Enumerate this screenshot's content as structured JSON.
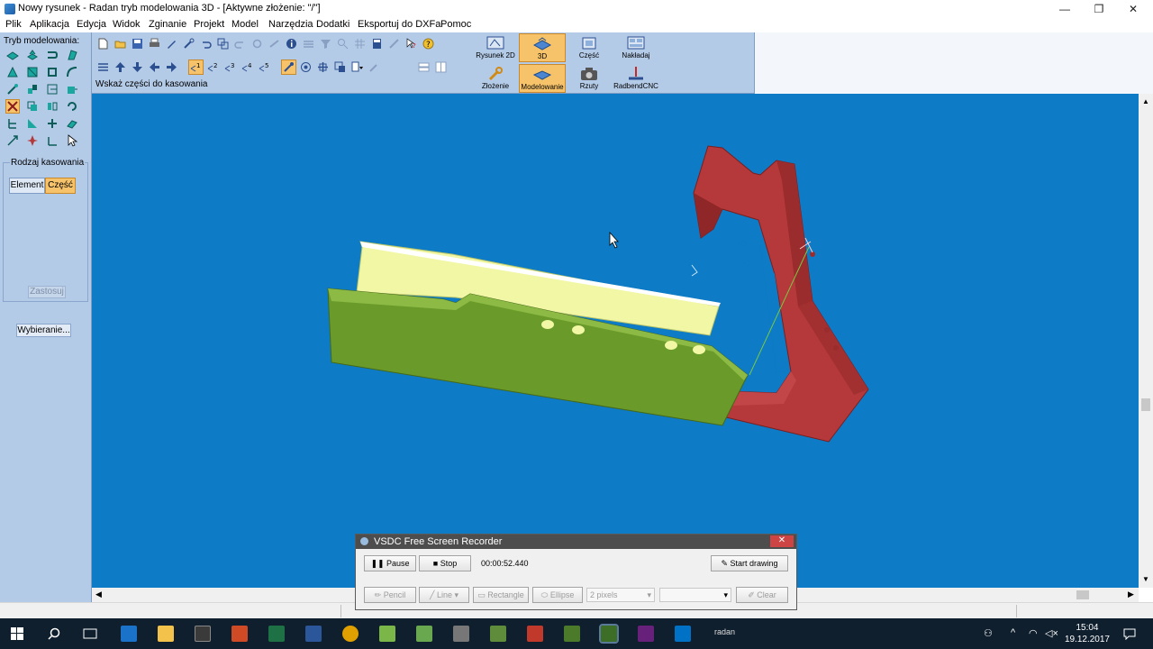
{
  "window": {
    "title": "Nowy rysunek - Radan tryb modelowania 3D - [Aktywne złożenie: \"/\"]",
    "controls": [
      "—",
      "❐",
      "✕"
    ]
  },
  "menu": [
    "Plik",
    "Aplikacja",
    "Edycja",
    "Widok",
    "Zginanie",
    "Projekt",
    "Model",
    "Narzędzia",
    "Dodatki",
    "Eksportuj do DXFa",
    "Pomoc"
  ],
  "left_panel": {
    "caption": "Tryb modelowania:",
    "group_label": "Rodzaj kasowania",
    "segment_element": "Element",
    "segment_czesc": "Część",
    "apply_button": "Zastosuj",
    "select_button": "Wybieranie..."
  },
  "toolbar": {
    "hint": "Wskaż części do kasowania",
    "view_labels": [
      "1",
      "2",
      "3",
      "4",
      "5"
    ]
  },
  "mode_tabs": {
    "top": [
      {
        "label": "Rysunek 2D",
        "active": false
      },
      {
        "label": "3D",
        "active": true
      },
      {
        "label": "Część",
        "active": false
      },
      {
        "label": "Nakładaj",
        "active": false
      }
    ],
    "bottom": [
      {
        "label": "Złożenie",
        "active": false
      },
      {
        "label": "Modelowanie",
        "active": true
      },
      {
        "label": "Rzuty",
        "active": false
      },
      {
        "label": "RadbendCNC",
        "active": false
      }
    ]
  },
  "recorder": {
    "title": "VSDC Free Screen Recorder",
    "pause": "Pause",
    "stop": "Stop",
    "time": "00:00:52.440",
    "start_drawing": "Start drawing",
    "pencil": "Pencil",
    "line": "Line",
    "rectangle": "Rectangle",
    "ellipse": "Ellipse",
    "thickness": "2 pixels",
    "clear": "Clear"
  },
  "taskbar": {
    "app_label": "radan",
    "time": "15:04",
    "date": "19.12.2017"
  },
  "colors": {
    "viewport": "#0d7bc5",
    "panel": "#b4cbe8",
    "highlight": "#f6c36b",
    "part_green": "#6a9b2a",
    "part_yellow": "#f1f7a4",
    "part_red": "#b5393a"
  }
}
